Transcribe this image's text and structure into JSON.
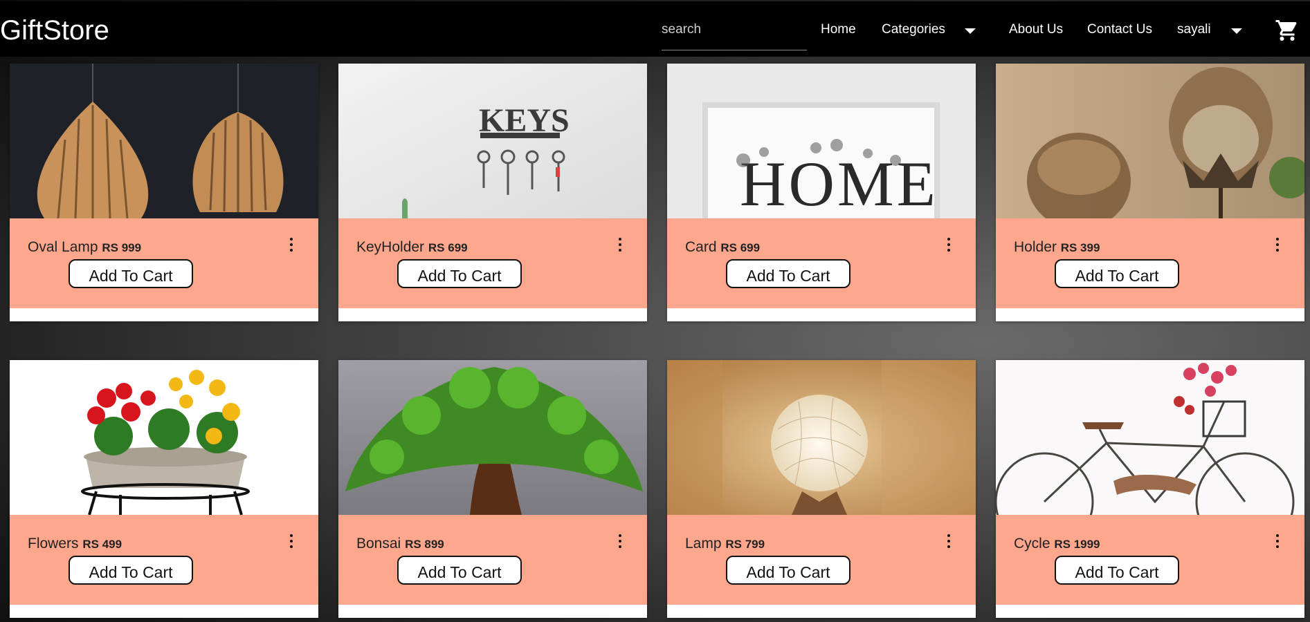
{
  "header": {
    "brand": "GiftStore",
    "search_placeholder": "search",
    "nav": {
      "home": "Home",
      "categories": "Categories",
      "about": "About Us",
      "contact": "Contact Us",
      "user": "sayali"
    }
  },
  "products": [
    {
      "name": "Oval Lamp",
      "price": "RS 999",
      "button": "Add To Cart"
    },
    {
      "name": "KeyHolder",
      "price": "RS 699",
      "button": "Add To Cart"
    },
    {
      "name": "Card",
      "price": "RS 699",
      "button": "Add To Cart"
    },
    {
      "name": "Holder",
      "price": "RS 399",
      "button": "Add To Cart"
    },
    {
      "name": "Flowers",
      "price": "RS 499",
      "button": "Add To Cart"
    },
    {
      "name": "Bonsai",
      "price": "RS 899",
      "button": "Add To Cart"
    },
    {
      "name": "Lamp",
      "price": "RS 799",
      "button": "Add To Cart"
    },
    {
      "name": "Cycle",
      "price": "RS 1999",
      "button": "Add To Cart"
    }
  ],
  "image_text": {
    "keys": "KEYS",
    "home": "HOME"
  },
  "icons": [
    "caret-down-icon",
    "cart-icon",
    "kebab-menu-icon"
  ],
  "colors": {
    "header_bg": "#000000",
    "info_bg": "#ffa78c",
    "button_bg": "#ffffff"
  }
}
